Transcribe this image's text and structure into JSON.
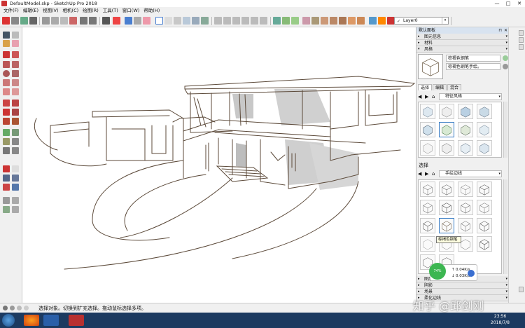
{
  "title": "DefaultModel.skp - SketchUp Pro 2018",
  "window_controls": [
    "—",
    "□",
    "✕"
  ],
  "menu": [
    "文件(F)",
    "编辑(E)",
    "视图(V)",
    "相机(C)",
    "绘图(R)",
    "工具(T)",
    "窗口(W)",
    "帮助(H)"
  ],
  "layer": {
    "current": "Layer0",
    "visible_mark": "✓",
    "dropdown": "▾"
  },
  "tray": {
    "title": "默认面板",
    "pin": "⊓",
    "close": "✕",
    "sections_top": [
      "图元信息",
      "材料",
      "风格"
    ],
    "style_name": "棕褐色钢笔",
    "style_description": "棕褐色钢笔手绘。",
    "tabs": [
      "选择",
      "编辑",
      "混合"
    ],
    "top_collection": "特征风格",
    "select_label": "选择",
    "bottom_collection": "手绘边线",
    "tooltip": "棕褐色钢笔",
    "sections_bottom": [
      "图层",
      "阴影",
      "场景",
      "柔化边线"
    ]
  },
  "status": {
    "text": "选择对象。切换到扩充选择。拖动鼠标选择多项。"
  },
  "network": {
    "percent": "74%",
    "up": "0.04K/s",
    "down": "0.03K/s",
    "up_arrow": "↑",
    "down_arrow": "↓"
  },
  "clock": {
    "time": "23:56",
    "date": "2018/7/8"
  },
  "watermark": "知乎 @邱剑刚",
  "colors": {
    "titlebar": "#ffffff",
    "menubar": "#f0f0f0",
    "tray_title": "#d8e3f0",
    "taskbar": "#1c3a60",
    "sketch_line": "#5c4a3a",
    "selection_blue": "#3c7fc6"
  },
  "icons": {
    "nav_back": "◀",
    "nav_forward": "▶",
    "home": "⌂",
    "expand": "▸",
    "collapse": "▾"
  }
}
